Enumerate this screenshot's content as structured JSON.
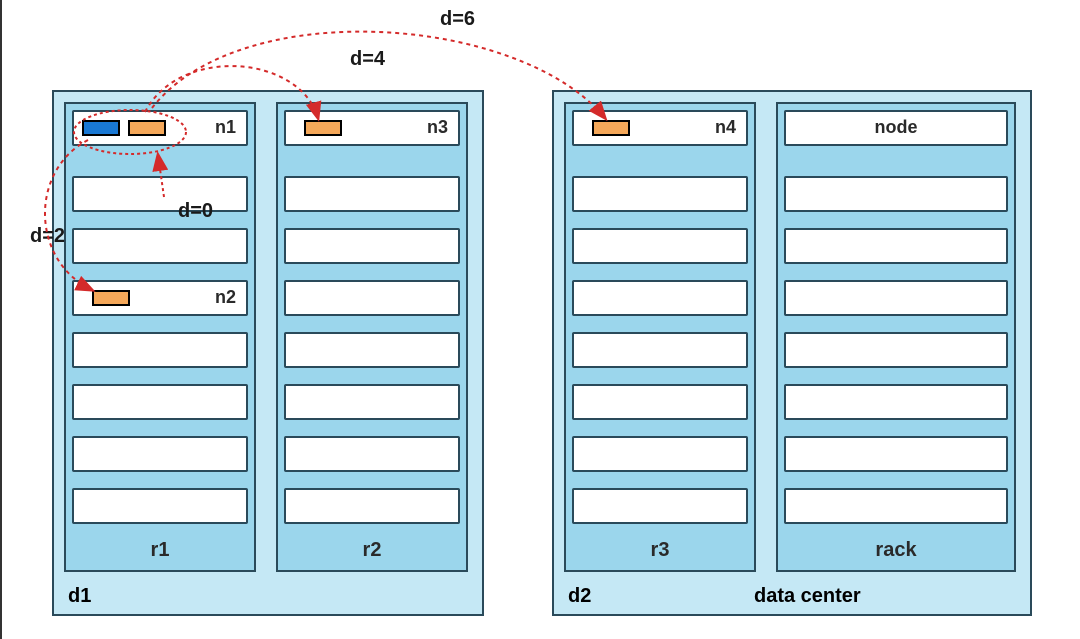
{
  "diagram": {
    "datacenters": [
      {
        "id": "d1",
        "label": "d1",
        "racks": [
          {
            "id": "r1",
            "label": "r1",
            "slots": [
              {
                "node": "n1",
                "blocks": [
                  "blue",
                  "orange"
                ]
              },
              {
                "node": null
              },
              {
                "node": null
              },
              {
                "node": "n2",
                "blocks": [
                  "orange"
                ]
              },
              {
                "node": null
              },
              {
                "node": null
              },
              {
                "node": null
              },
              {
                "node": null
              }
            ]
          },
          {
            "id": "r2",
            "label": "r2",
            "slots": [
              {
                "node": "n3",
                "blocks": [
                  "orange"
                ]
              },
              {
                "node": null
              },
              {
                "node": null
              },
              {
                "node": null
              },
              {
                "node": null
              },
              {
                "node": null
              },
              {
                "node": null
              },
              {
                "node": null
              }
            ]
          }
        ]
      },
      {
        "id": "d2",
        "label": "d2",
        "caption": "data center",
        "racks": [
          {
            "id": "r3",
            "label": "r3",
            "slots": [
              {
                "node": "n4",
                "blocks": [
                  "orange"
                ]
              },
              {
                "node": null
              },
              {
                "node": null
              },
              {
                "node": null
              },
              {
                "node": null
              },
              {
                "node": null
              },
              {
                "node": null
              },
              {
                "node": null
              }
            ]
          },
          {
            "id": "rack",
            "label": "rack",
            "slots": [
              {
                "node": "node",
                "blocks": []
              },
              {
                "node": null
              },
              {
                "node": null
              },
              {
                "node": null
              },
              {
                "node": null
              },
              {
                "node": null
              },
              {
                "node": null
              },
              {
                "node": null
              }
            ]
          }
        ]
      }
    ],
    "distances": {
      "d0": {
        "label": "d=0",
        "from": "n1-blue",
        "to": "n1-orange",
        "value": 0
      },
      "d2": {
        "label": "d=2",
        "from": "n1",
        "to": "n2",
        "value": 2
      },
      "d4": {
        "label": "d=4",
        "from": "n1",
        "to": "n3",
        "value": 4
      },
      "d6": {
        "label": "d=6",
        "from": "n1",
        "to": "n4",
        "value": 6
      }
    },
    "colors": {
      "rack_bg": "#9bd6ec",
      "dc_bg": "#c5e8f5",
      "border": "#2a4a5a",
      "blue_block": "#1978d4",
      "orange_block": "#f5a85a",
      "arrow": "#d42a2a"
    }
  }
}
